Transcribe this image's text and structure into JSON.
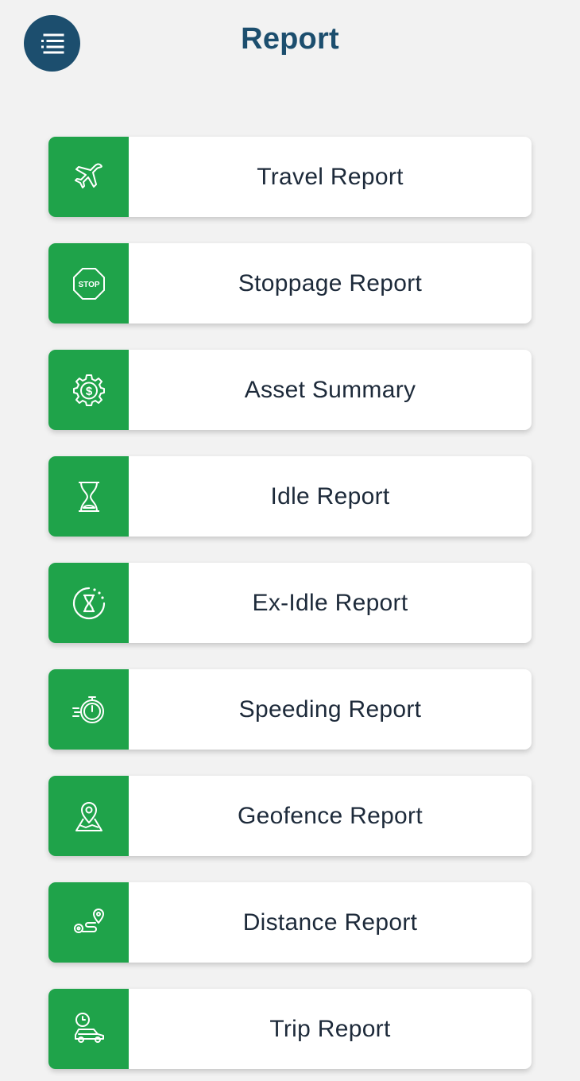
{
  "header": {
    "title": "Report",
    "menu_icon": "menu-list-icon"
  },
  "colors": {
    "header_accent": "#1c4e6e",
    "icon_tile": "#1fa34a",
    "card_bg": "#ffffff",
    "page_bg": "#f2f2f2"
  },
  "reports": [
    {
      "label": "Travel Report",
      "icon": "airplane-icon"
    },
    {
      "label": "Stoppage Report",
      "icon": "stop-sign-icon"
    },
    {
      "label": "Asset Summary",
      "icon": "gear-dollar-icon"
    },
    {
      "label": "Idle Report",
      "icon": "hourglass-icon"
    },
    {
      "label": "Ex-Idle Report",
      "icon": "hourglass-circle-icon"
    },
    {
      "label": "Speeding Report",
      "icon": "speed-stopwatch-icon"
    },
    {
      "label": "Geofence Report",
      "icon": "map-pin-icon"
    },
    {
      "label": "Distance Report",
      "icon": "route-icon"
    },
    {
      "label": "Trip Report",
      "icon": "car-clock-icon"
    }
  ]
}
